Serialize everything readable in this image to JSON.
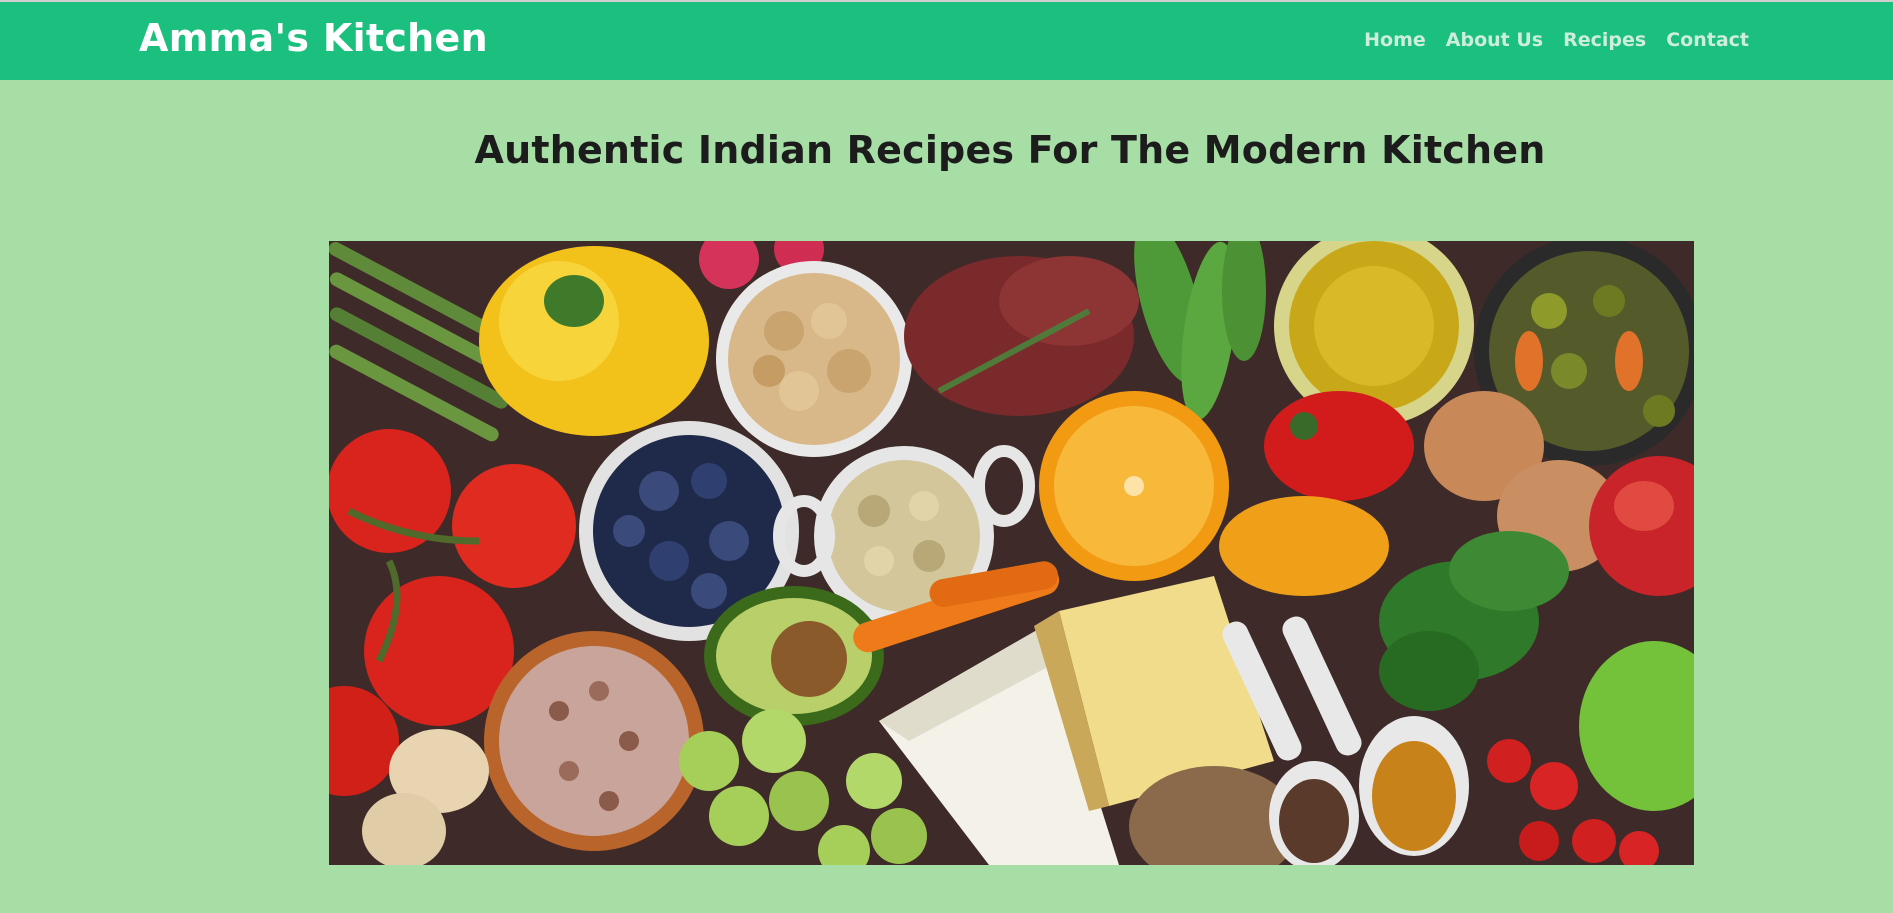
{
  "navbar": {
    "brand": "Amma's Kitchen",
    "links": [
      {
        "label": "Home"
      },
      {
        "label": "About Us"
      },
      {
        "label": "Recipes"
      },
      {
        "label": "Contact"
      }
    ]
  },
  "main": {
    "headline": "Authentic Indian Recipes For The Modern Kitchen",
    "hero_image_description": "hero-image"
  },
  "colors": {
    "navbar": "#1bbf7e",
    "background": "#a6dea6",
    "brand_text": "#ffffff",
    "nav_text": "#cdeedc",
    "headline_text": "#1c1c1c"
  }
}
